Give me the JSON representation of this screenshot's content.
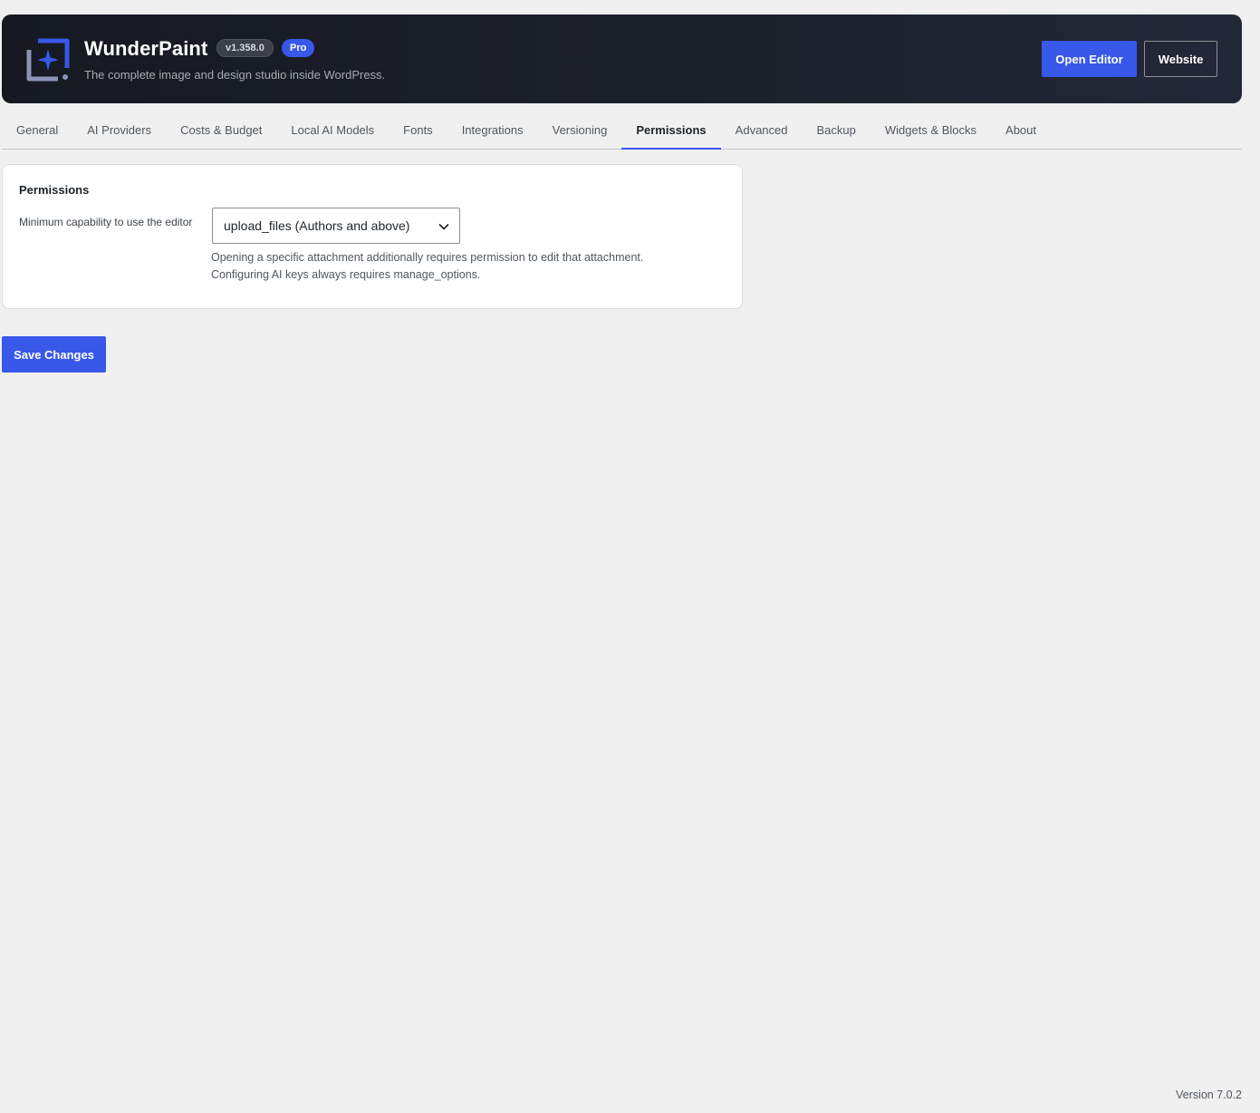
{
  "header": {
    "title": "WunderPaint",
    "version": "v1.358.0",
    "plan_badge": "Pro",
    "tagline": "The complete image and design studio inside WordPress.",
    "open_editor_label": "Open Editor",
    "website_label": "Website",
    "logo_icon": "wunderpaint-logo-icon",
    "accent_color": "#3858e9"
  },
  "tabs": [
    {
      "label": "General"
    },
    {
      "label": "AI Providers"
    },
    {
      "label": "Costs & Budget"
    },
    {
      "label": "Local AI Models"
    },
    {
      "label": "Fonts"
    },
    {
      "label": "Integrations"
    },
    {
      "label": "Versioning"
    },
    {
      "label": "Permissions",
      "active": true
    },
    {
      "label": "Advanced"
    },
    {
      "label": "Backup"
    },
    {
      "label": "Widgets & Blocks"
    },
    {
      "label": "About"
    }
  ],
  "permissions": {
    "section_title": "Permissions",
    "capability_label": "Minimum capability to use the editor",
    "capability_value": "upload_files (Authors and above)",
    "help_line1": "Opening a specific attachment additionally requires permission to edit that attachment.",
    "help_line2": "Configuring AI keys always requires manage_options."
  },
  "actions": {
    "save_label": "Save Changes"
  },
  "footer": {
    "version_text": "Version 7.0.2"
  }
}
